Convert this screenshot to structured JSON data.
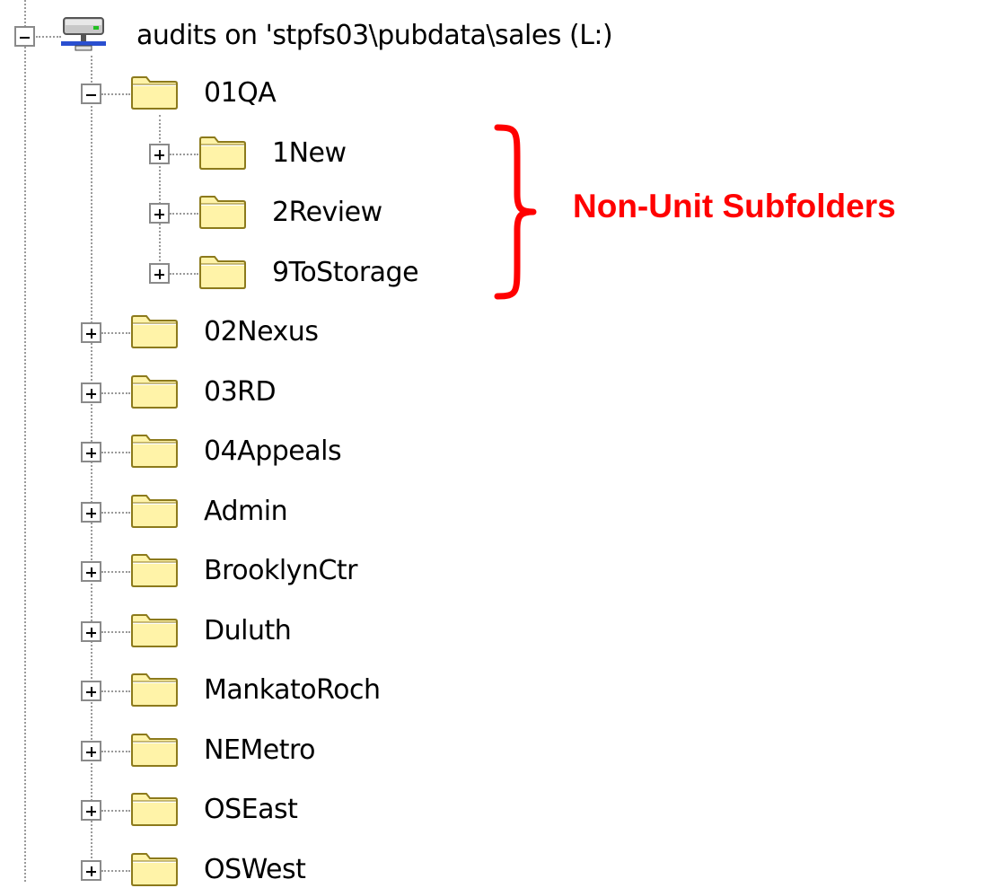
{
  "tree": {
    "root": {
      "label": "audits on 'stpfs03\\pubdata\\sales (L:)",
      "icon": "network-drive-icon",
      "expander": "minus"
    },
    "items": [
      {
        "label": "01QA",
        "depth": 1,
        "expander": "minus",
        "icon": "folder-icon"
      },
      {
        "label": "1New",
        "depth": 2,
        "expander": "plus",
        "icon": "folder-icon"
      },
      {
        "label": "2Review",
        "depth": 2,
        "expander": "plus",
        "icon": "folder-icon"
      },
      {
        "label": "9ToStorage",
        "depth": 2,
        "expander": "plus",
        "icon": "folder-icon"
      },
      {
        "label": "02Nexus",
        "depth": 1,
        "expander": "plus",
        "icon": "folder-icon"
      },
      {
        "label": "03RD",
        "depth": 1,
        "expander": "plus",
        "icon": "folder-icon"
      },
      {
        "label": "04Appeals",
        "depth": 1,
        "expander": "plus",
        "icon": "folder-icon"
      },
      {
        "label": "Admin",
        "depth": 1,
        "expander": "plus",
        "icon": "folder-icon"
      },
      {
        "label": "BrooklynCtr",
        "depth": 1,
        "expander": "plus",
        "icon": "folder-icon"
      },
      {
        "label": "Duluth",
        "depth": 1,
        "expander": "plus",
        "icon": "folder-icon"
      },
      {
        "label": "MankatoRoch",
        "depth": 1,
        "expander": "plus",
        "icon": "folder-icon"
      },
      {
        "label": "NEMetro",
        "depth": 1,
        "expander": "plus",
        "icon": "folder-icon"
      },
      {
        "label": "OSEast",
        "depth": 1,
        "expander": "plus",
        "icon": "folder-icon"
      },
      {
        "label": "OSWest",
        "depth": 1,
        "expander": "plus",
        "icon": "folder-icon"
      }
    ]
  },
  "annotation": {
    "text": "Non-Unit Subfolders",
    "color": "#ff0000",
    "brace_icon": "curly-brace-icon"
  },
  "colors": {
    "folder_fill": "#fff3a8",
    "folder_border": "#8c7a1c",
    "tree_lines": "#9a9a9a",
    "expander_border": "#8a8a8a"
  }
}
